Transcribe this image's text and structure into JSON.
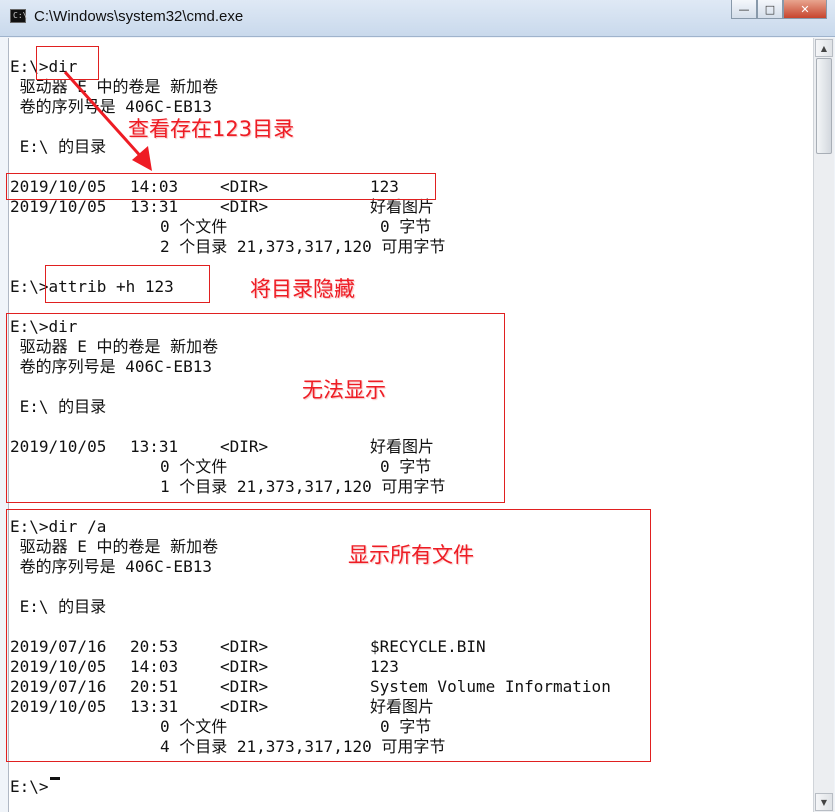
{
  "window": {
    "title": "C:\\Windows\\system32\\cmd.exe",
    "icon": "cmd-app-icon",
    "controls": {
      "minimize": "—",
      "maximize": "□",
      "close": "✕"
    }
  },
  "console": {
    "l0": {
      "a": "E:\\>dir"
    },
    "l1": {
      "a": " 驱动器 E 中的卷是 新加卷"
    },
    "l2": {
      "a": " 卷的序列号是 406C-EB13"
    },
    "l4": {
      "a": " E:\\ 的目录"
    },
    "l6": {
      "date": "2019/10/05",
      "time": "14:03",
      "type": "<DIR>",
      "name": "123"
    },
    "l7": {
      "date": "2019/10/05",
      "time": "13:31",
      "type": "<DIR>",
      "name": "好看图片"
    },
    "l8": {
      "a": "0 个文件",
      "b": "0 字节"
    },
    "l9": {
      "a": "2 个目录 21,373,317,120 可用字节"
    },
    "l11": {
      "a": "E:\\>attrib +h 123"
    },
    "l13": {
      "a": "E:\\>dir"
    },
    "l14": {
      "a": " 驱动器 E 中的卷是 新加卷"
    },
    "l15": {
      "a": " 卷的序列号是 406C-EB13"
    },
    "l17": {
      "a": " E:\\ 的目录"
    },
    "l19": {
      "date": "2019/10/05",
      "time": "13:31",
      "type": "<DIR>",
      "name": "好看图片"
    },
    "l20": {
      "a": "0 个文件",
      "b": "0 字节"
    },
    "l21": {
      "a": "1 个目录 21,373,317,120 可用字节"
    },
    "l23": {
      "a": "E:\\>dir /a"
    },
    "l24": {
      "a": " 驱动器 E 中的卷是 新加卷"
    },
    "l25": {
      "a": " 卷的序列号是 406C-EB13"
    },
    "l27": {
      "a": " E:\\ 的目录"
    },
    "l29": {
      "date": "2019/07/16",
      "time": "20:53",
      "type": "<DIR>",
      "name": "$RECYCLE.BIN"
    },
    "l30": {
      "date": "2019/10/05",
      "time": "14:03",
      "type": "<DIR>",
      "name": "123"
    },
    "l31": {
      "date": "2019/07/16",
      "time": "20:51",
      "type": "<DIR>",
      "name": "System Volume Information"
    },
    "l32": {
      "date": "2019/10/05",
      "time": "13:31",
      "type": "<DIR>",
      "name": "好看图片"
    },
    "l33": {
      "a": "0 个文件",
      "b": "0 字节"
    },
    "l34": {
      "a": "4 个目录 21,373,317,120 可用字节"
    },
    "l36": {
      "a": "E:\\>"
    }
  },
  "annotations": {
    "check_123": "查看存在123目录",
    "hide_dir": "将目录隐藏",
    "cannot_show": "无法显示",
    "show_all": "显示所有文件"
  },
  "colors": {
    "annotation": "#ee1c24",
    "console_text": "#111111",
    "console_bg": "#ffffff"
  }
}
